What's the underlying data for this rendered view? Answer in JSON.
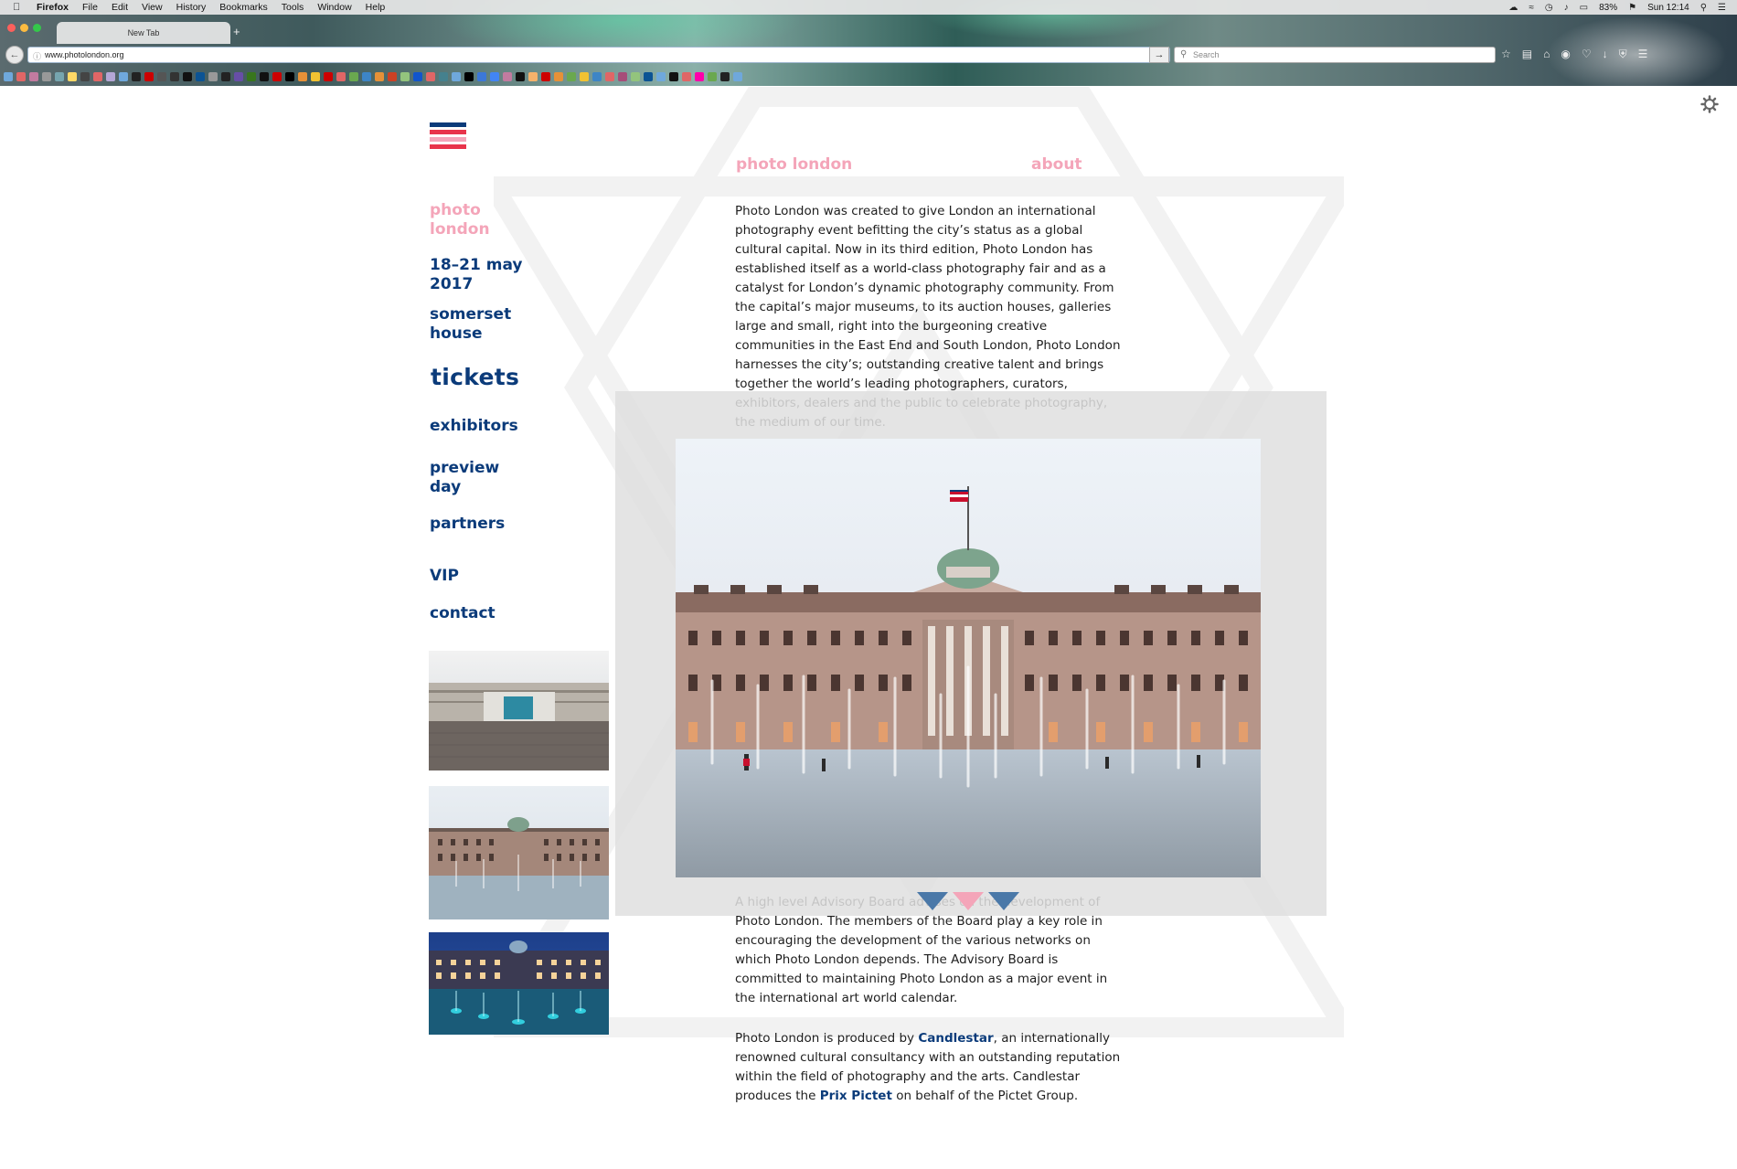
{
  "menubar": {
    "app": "Firefox",
    "items": [
      "File",
      "Edit",
      "View",
      "History",
      "Bookmarks",
      "Tools",
      "Window",
      "Help"
    ],
    "battery": "83%",
    "clock": "Sun 12:14"
  },
  "browser": {
    "tab_title": "New Tab",
    "url": "www.photolondon.org",
    "search_placeholder": "Search"
  },
  "sidebar": {
    "brand_line1": "photo",
    "brand_line2": "london",
    "dates_line1": "18–21 may",
    "dates_line2": "2017",
    "venue_line1": "somerset",
    "venue_line2": "house",
    "nav": {
      "tickets": "tickets",
      "exhibitors": "exhibitors",
      "preview_line1": "preview",
      "preview_line2": "day",
      "partners": "partners",
      "vip": "VIP",
      "contact": "contact"
    }
  },
  "content": {
    "heading_left": "photo london",
    "heading_right": "about",
    "para1": "Photo London was created to give London an international photography event befitting the city’s status as a global cultural capital. Now in its third edition, Photo London has established itself as a world-class photography fair and as a catalyst for London’s dynamic photography community. From the capital’s major museums, to its auction houses, galleries large and small, right into the burgeoning creative communities in the East End and South London, Photo London harnesses the city’s; outstanding creative talent and brings together the world’s leading photographers, curators, exhibitors, dealers and the public to celebrate photography, the medium of our time.",
    "para2": "A high level Advisory Board advises on the development of Photo London. The members of the Board play a key role in encouraging the development of the various networks on which Photo London depends. The Advisory Board is committed to maintaining Photo London as a major event in the international art world calendar.",
    "para3_a": "Photo London is produced by ",
    "para3_link1": "Candlestar",
    "para3_b": ", an internationally renowned cultural consultancy with an outstanding reputation within the field of photography and the arts. Candlestar produces the ",
    "para3_link2": "Prix Pictet",
    "para3_c": " on behalf of the Pictet Group."
  },
  "colors": {
    "navy": "#0b3b7a",
    "pink": "#f4a5b9",
    "overlay": "#e0e0e0",
    "triangle_blue": "#4a78a8"
  }
}
